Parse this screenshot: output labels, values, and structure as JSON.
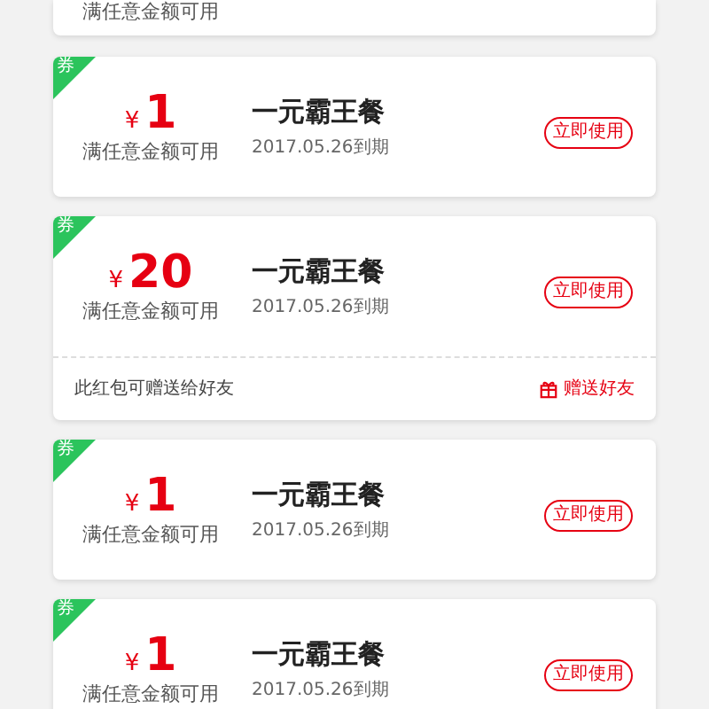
{
  "partial_card": {
    "condition": "满任意金额可用"
  },
  "coupons": [
    {
      "tag": "券",
      "currency": "¥",
      "amount": "1",
      "condition": "满任意金额可用",
      "title": "一元霸王餐",
      "expiry": "2017.05.26到期",
      "button": "立即使用"
    },
    {
      "tag": "券",
      "currency": "¥",
      "amount": "20",
      "condition": "满任意金额可用",
      "title": "一元霸王餐",
      "expiry": "2017.05.26到期",
      "button": "立即使用",
      "gift": {
        "note": "此红包可赠送给好友",
        "action": "赠送好友"
      }
    },
    {
      "tag": "券",
      "currency": "¥",
      "amount": "1",
      "condition": "满任意金额可用",
      "title": "一元霸王餐",
      "expiry": "2017.05.26到期",
      "button": "立即使用"
    },
    {
      "tag": "券",
      "currency": "¥",
      "amount": "1",
      "condition": "满任意金额可用",
      "title": "一元霸王餐",
      "expiry": "2017.05.26到期",
      "button": "立即使用"
    }
  ]
}
